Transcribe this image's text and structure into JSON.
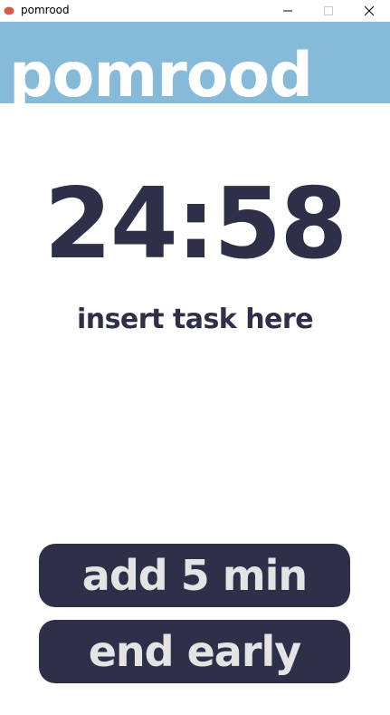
{
  "window": {
    "title": "pomrood",
    "app_icon": "tomato-icon",
    "controls": [
      "minimize-icon",
      "maximize-icon",
      "close-icon"
    ]
  },
  "header": {
    "logo_text": "pomrood"
  },
  "timer": {
    "display": "24:58"
  },
  "task": {
    "label": "insert task here"
  },
  "actions": {
    "add_label": "add 5 min",
    "end_label": "end early"
  },
  "colors": {
    "header_bg": "#85bad9",
    "ink": "#2e2f48",
    "button_bg": "#2e2f48",
    "button_text": "#e4e4e4",
    "background": "#ffffff"
  }
}
